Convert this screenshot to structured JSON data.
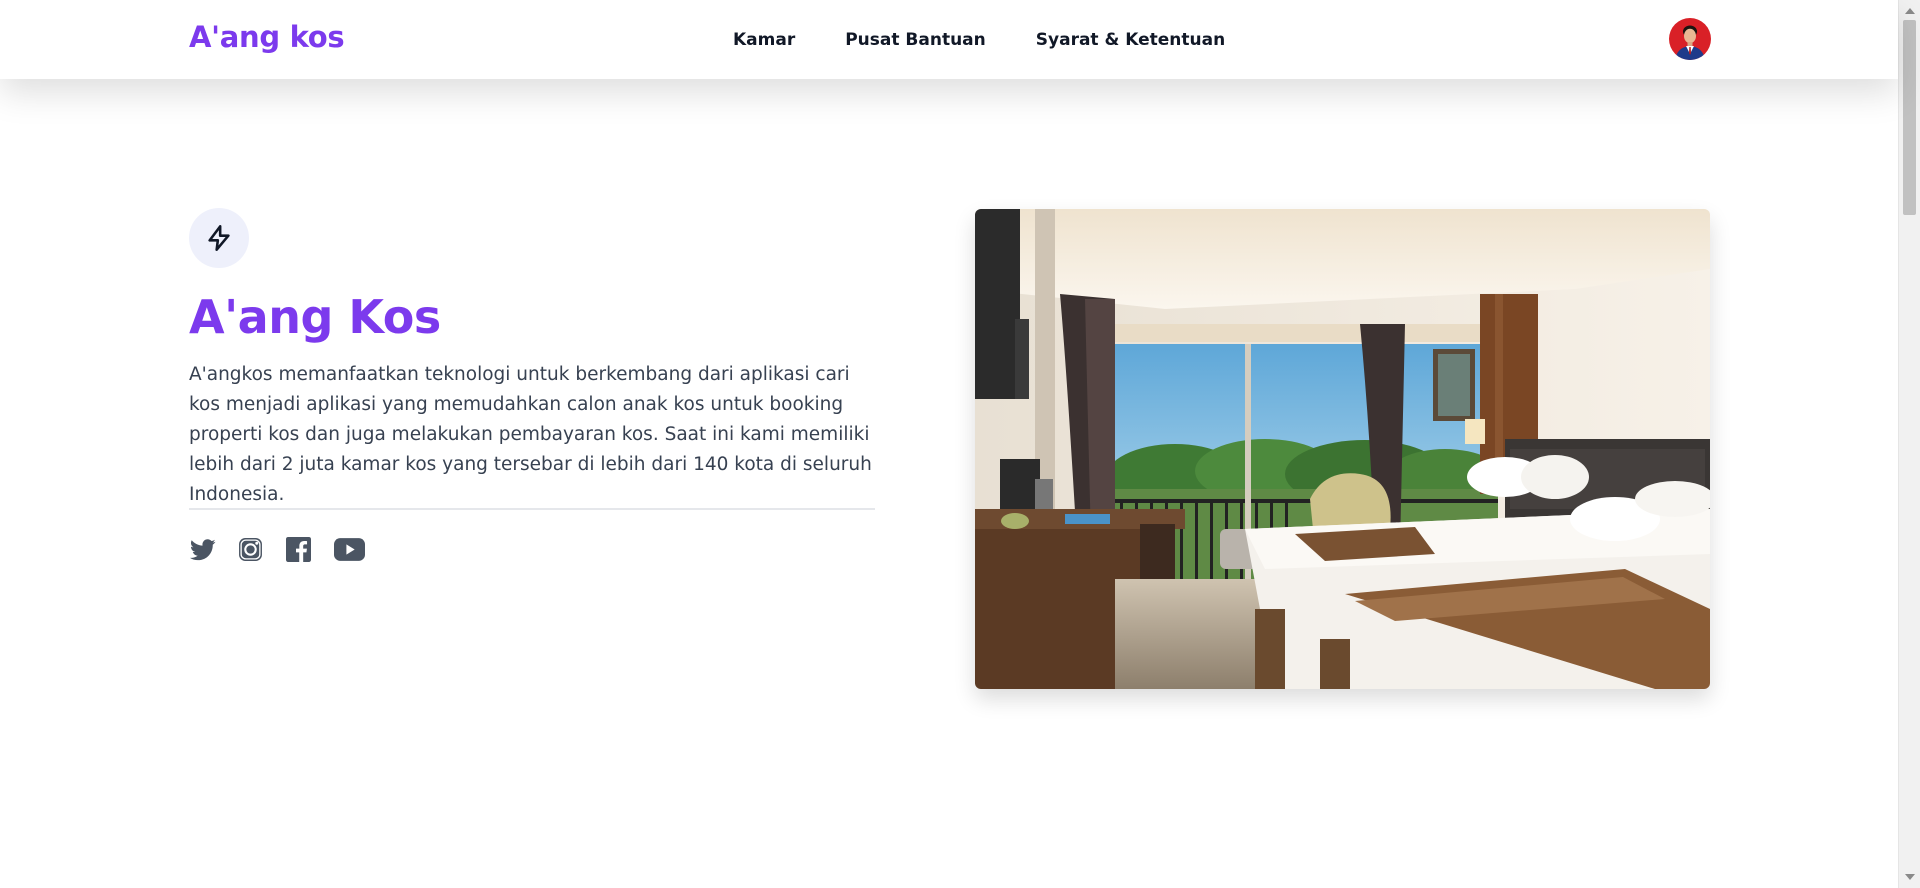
{
  "brand": "A'ang kos",
  "nav": {
    "items": [
      {
        "label": "Kamar"
      },
      {
        "label": "Pusat Bantuan"
      },
      {
        "label": "Syarat & Ketentuan"
      }
    ]
  },
  "user": {
    "avatar_icon": "user-avatar"
  },
  "hero": {
    "icon": "lightning-bolt-icon",
    "title": "A'ang Kos",
    "description": "A'angkos memanfaatkan teknologi untuk berkembang dari aplikasi cari kos menjadi aplikasi yang memudahkan calon anak kos untuk booking properti kos dan juga melakukan pembayaran kos. Saat ini kami memiliki lebih dari 2 juta kamar kos yang tersebar di lebih dari 140 kota di seluruh Indonesia.",
    "image": "hotel-room-photo"
  },
  "socials": [
    {
      "icon": "twitter-icon"
    },
    {
      "icon": "instagram-icon"
    },
    {
      "icon": "facebook-icon"
    },
    {
      "icon": "youtube-icon"
    }
  ],
  "colors": {
    "brand": "#7c3aed",
    "text": "#374151",
    "heading": "#111827",
    "icon_bg": "#eef0fb",
    "social_icon": "#4b5563"
  }
}
